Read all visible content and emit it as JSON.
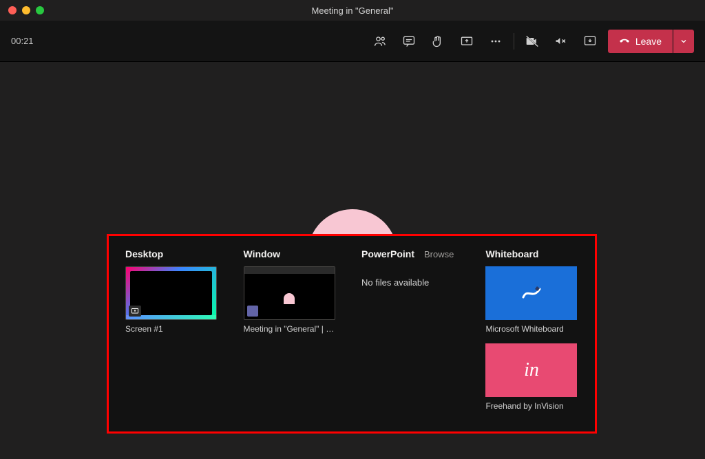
{
  "window_title": "Meeting in \"General\"",
  "timer": "00:21",
  "leave_label": "Leave",
  "share": {
    "desktop": {
      "header": "Desktop",
      "items": [
        {
          "label": "Screen #1"
        }
      ]
    },
    "window": {
      "header": "Window",
      "items": [
        {
          "label": "Meeting in \"General\" | M…"
        }
      ]
    },
    "powerpoint": {
      "header": "PowerPoint",
      "browse_label": "Browse",
      "empty_text": "No files available"
    },
    "whiteboard": {
      "header": "Whiteboard",
      "items": [
        {
          "label": "Microsoft Whiteboard"
        },
        {
          "label": "Freehand by InVision"
        }
      ]
    }
  },
  "colors": {
    "accent_leave": "#c4314b",
    "highlight_box": "#ff0000",
    "avatar": "#f8c7d3",
    "ms_whiteboard": "#1a6fd9",
    "invision": "#e84a72"
  }
}
